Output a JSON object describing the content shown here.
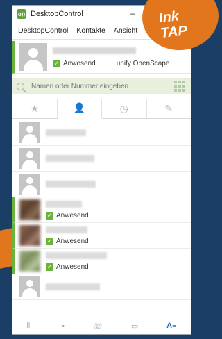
{
  "window": {
    "title": "DesktopControl",
    "app_icon": "o))",
    "minimize_symbol": "–"
  },
  "menu": {
    "items": [
      "DesktopControl",
      "Kontakte",
      "Ansicht"
    ]
  },
  "profile": {
    "status": "Anwesend",
    "server": "unify OpenScape"
  },
  "search": {
    "placeholder": "Namen oder Nummer eingeben"
  },
  "tabs": [
    {
      "icon": "star-icon",
      "glyph": "★"
    },
    {
      "icon": "person-icon",
      "glyph": "👤"
    },
    {
      "icon": "clock-icon",
      "glyph": "◷"
    },
    {
      "icon": "wrench-icon",
      "glyph": "✎"
    }
  ],
  "contacts": [
    {
      "presence": "offline",
      "status": ""
    },
    {
      "presence": "offline",
      "status": ""
    },
    {
      "presence": "offline",
      "status": ""
    },
    {
      "presence": "online",
      "status": "Anwesend"
    },
    {
      "presence": "online",
      "status": "Anwesend"
    },
    {
      "presence": "online",
      "status": "Anwesend"
    },
    {
      "presence": "offline",
      "status": ""
    }
  ],
  "bottombar": {
    "buttons": [
      "⫴",
      "⊸",
      "☏",
      "▭",
      "A≡"
    ]
  },
  "badge": {
    "line1": "Ink",
    "line2": "TAP"
  },
  "colors": {
    "accent_green": "#6ab43b",
    "accent_blue": "#2a6fb5",
    "badge_orange": "#e2761d",
    "background_navy": "#1b3e66"
  }
}
